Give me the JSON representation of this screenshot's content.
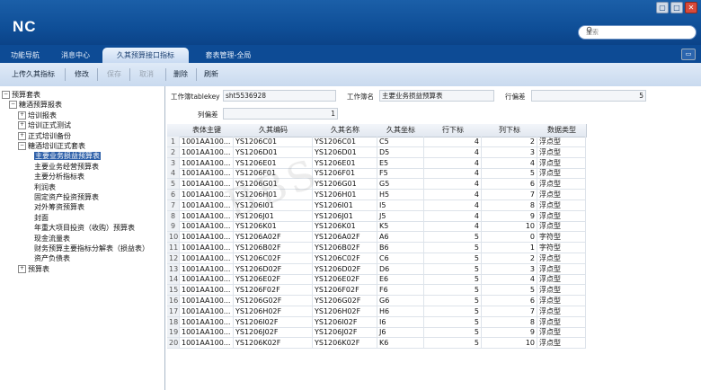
{
  "app": {
    "logo": "NC"
  },
  "window_buttons": [
    "▢",
    "□",
    "✕"
  ],
  "search": {
    "placeholder": "搜索"
  },
  "tabs": [
    {
      "label": "功能导航"
    },
    {
      "label": "消息中心"
    },
    {
      "label": "久其预算接口指标"
    },
    {
      "label": "套表管理-全局"
    }
  ],
  "toolbar": {
    "upload_label": "上传久其指标",
    "edit_label": "修改",
    "save_label": "保存",
    "cancel_label": "取消",
    "delete_label": "删除",
    "refresh_label": "刷新"
  },
  "tree": [
    {
      "label": "预算套表",
      "exp": "⊟"
    },
    {
      "label": "糖酒预算报表",
      "exp": "⊟"
    },
    {
      "label": "培训报表",
      "exp": "⊞"
    },
    {
      "label": "培训正式测试",
      "exp": "⊞"
    },
    {
      "label": "正式培训备份",
      "exp": "⊞"
    },
    {
      "label": "糖酒培训正式套表",
      "exp": "⊟"
    },
    {
      "label": "主要业务损益预算表",
      "exp": ""
    },
    {
      "label": "主要业务经营预算表",
      "exp": ""
    },
    {
      "label": "主要分析指标表",
      "exp": ""
    },
    {
      "label": "利润表",
      "exp": ""
    },
    {
      "label": "固定资产投资预算表",
      "exp": ""
    },
    {
      "label": "对外筹资预算表",
      "exp": ""
    },
    {
      "label": "封面",
      "exp": ""
    },
    {
      "label": "年重大项目投资（收购）预算表",
      "exp": ""
    },
    {
      "label": "现金流量表",
      "exp": ""
    },
    {
      "label": "财务预算主要指标分解表（损益表）",
      "exp": ""
    },
    {
      "label": "资产负债表",
      "exp": ""
    },
    {
      "label": "预算表",
      "exp": "⊞"
    }
  ],
  "form": {
    "tablekey_label": "工作簿tablekey",
    "tablekey_value": "sht5536928",
    "sheetname_label": "工作簿名",
    "sheetname_value": "主要业务损益预算表",
    "rowoffset_label": "行偏差",
    "rowoffset_value": "5",
    "coloffset_label": "列偏差",
    "coloffset_value": "1"
  },
  "grid": {
    "headers": [
      "表体主键",
      "久其编码",
      "久其名称",
      "久其坐标",
      "行下标",
      "列下标",
      "数据类型"
    ],
    "rows": [
      [
        "1",
        "1001AA100...",
        "YS1206C01",
        "YS1206C01",
        "C5",
        "4",
        "2",
        "浮点型"
      ],
      [
        "2",
        "1001AA100...",
        "YS1206D01",
        "YS1206D01",
        "D5",
        "4",
        "3",
        "浮点型"
      ],
      [
        "3",
        "1001AA100...",
        "YS1206E01",
        "YS1206E01",
        "E5",
        "4",
        "4",
        "浮点型"
      ],
      [
        "4",
        "1001AA100...",
        "YS1206F01",
        "YS1206F01",
        "F5",
        "4",
        "5",
        "浮点型"
      ],
      [
        "5",
        "1001AA100...",
        "YS1206G01",
        "YS1206G01",
        "G5",
        "4",
        "6",
        "浮点型"
      ],
      [
        "6",
        "1001AA100...",
        "YS1206H01",
        "YS1206H01",
        "H5",
        "4",
        "7",
        "浮点型"
      ],
      [
        "7",
        "1001AA100...",
        "YS1206I01",
        "YS1206I01",
        "I5",
        "4",
        "8",
        "浮点型"
      ],
      [
        "8",
        "1001AA100...",
        "YS1206J01",
        "YS1206J01",
        "J5",
        "4",
        "9",
        "浮点型"
      ],
      [
        "9",
        "1001AA100...",
        "YS1206K01",
        "YS1206K01",
        "K5",
        "4",
        "10",
        "浮点型"
      ],
      [
        "10",
        "1001AA100...",
        "YS1206A02F",
        "YS1206A02F",
        "A6",
        "5",
        "0",
        "字符型"
      ],
      [
        "11",
        "1001AA100...",
        "YS1206B02F",
        "YS1206B02F",
        "B6",
        "5",
        "1",
        "字符型"
      ],
      [
        "12",
        "1001AA100...",
        "YS1206C02F",
        "YS1206C02F",
        "C6",
        "5",
        "2",
        "浮点型"
      ],
      [
        "13",
        "1001AA100...",
        "YS1206D02F",
        "YS1206D02F",
        "D6",
        "5",
        "3",
        "浮点型"
      ],
      [
        "14",
        "1001AA100...",
        "YS1206E02F",
        "YS1206E02F",
        "E6",
        "5",
        "4",
        "浮点型"
      ],
      [
        "15",
        "1001AA100...",
        "YS1206F02F",
        "YS1206F02F",
        "F6",
        "5",
        "5",
        "浮点型"
      ],
      [
        "16",
        "1001AA100...",
        "YS1206G02F",
        "YS1206G02F",
        "G6",
        "5",
        "6",
        "浮点型"
      ],
      [
        "17",
        "1001AA100...",
        "YS1206H02F",
        "YS1206H02F",
        "H6",
        "5",
        "7",
        "浮点型"
      ],
      [
        "18",
        "1001AA100...",
        "YS1206I02F",
        "YS1206I02F",
        "I6",
        "5",
        "8",
        "浮点型"
      ],
      [
        "19",
        "1001AA100...",
        "YS1206J02F",
        "YS1206J02F",
        "J6",
        "5",
        "9",
        "浮点型"
      ],
      [
        "20",
        "1001AA100...",
        "YS1206K02F",
        "YS1206K02F",
        "K6",
        "5",
        "10",
        "浮点型"
      ]
    ]
  },
  "watermark": "BBS"
}
